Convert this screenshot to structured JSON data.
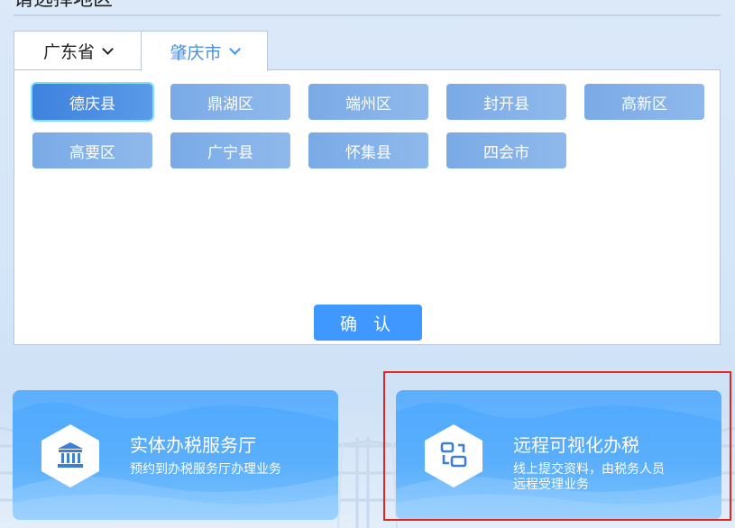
{
  "page": {
    "title": "请选择地区"
  },
  "tabs": [
    {
      "label": "广东省",
      "active": false
    },
    {
      "label": "肇庆市",
      "active": true
    }
  ],
  "districts": [
    {
      "label": "德庆县",
      "selected": true
    },
    {
      "label": "鼎湖区",
      "selected": false
    },
    {
      "label": "端州区",
      "selected": false
    },
    {
      "label": "封开县",
      "selected": false
    },
    {
      "label": "高新区",
      "selected": false
    },
    {
      "label": "高要区",
      "selected": false
    },
    {
      "label": "广宁县",
      "selected": false
    },
    {
      "label": "怀集县",
      "selected": false
    },
    {
      "label": "四会市",
      "selected": false
    }
  ],
  "confirm_label": "确 认",
  "cards": [
    {
      "title": "实体办税服务厅",
      "subtitle": "预约到办税服务厅办理业务",
      "icon": "building-icon"
    },
    {
      "title": "远程可视化办税",
      "subtitle_line1": "线上提交资料，由税务人员",
      "subtitle_line2": "远程受理业务",
      "icon": "remote-visual-icon",
      "highlighted": true
    }
  ],
  "colors": {
    "accent": "#3f98ff",
    "tab_active_text": "#4a90e2",
    "district_bg": "#8fb9ec",
    "district_selected_bg": "#3d82de",
    "district_selected_border": "#7fe3f2",
    "card_bg": "#50aaff",
    "highlight_border": "#e3261c"
  }
}
